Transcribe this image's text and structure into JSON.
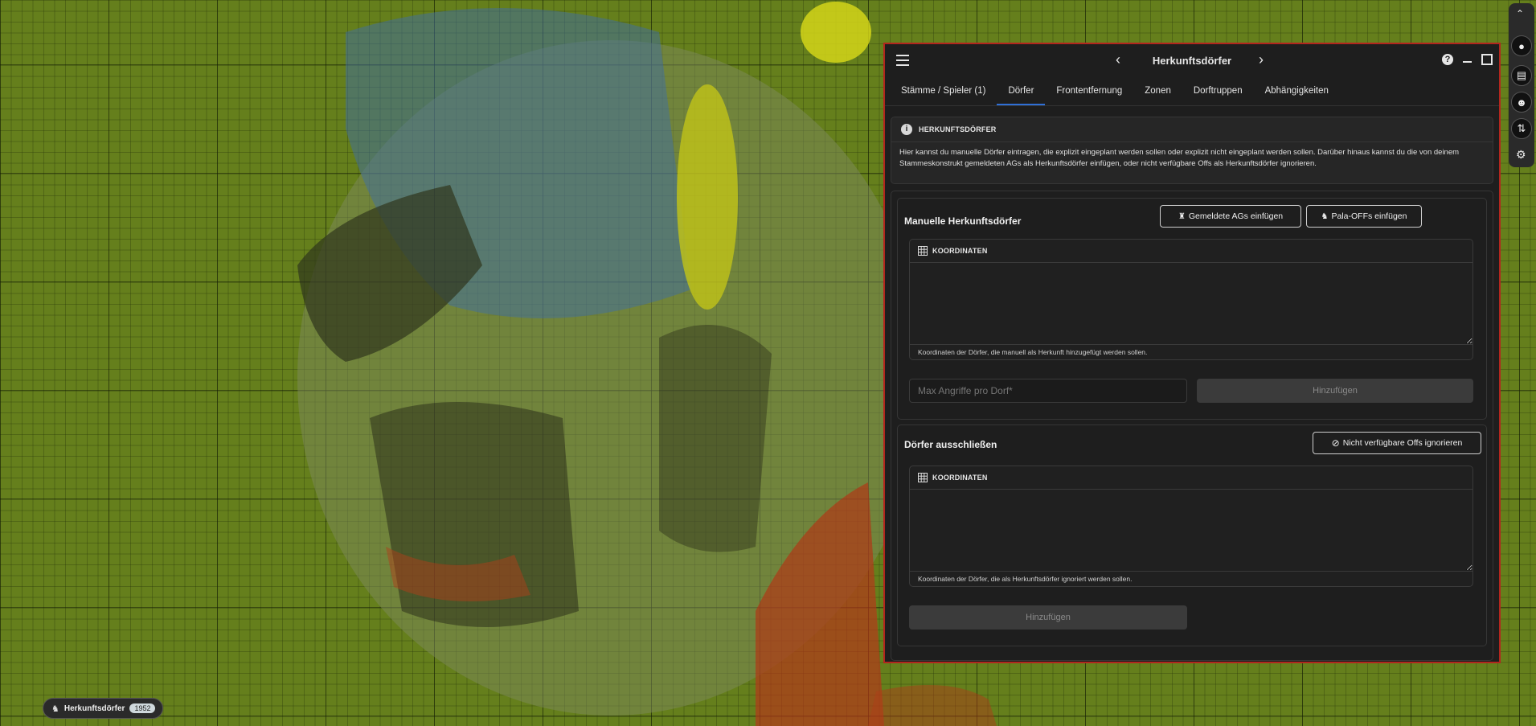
{
  "window": {
    "title": "Herkunftsdörfer",
    "help_icon": "help-icon",
    "minimize_icon": "minimize-icon",
    "maximize_icon": "maximize-icon"
  },
  "tabs": [
    {
      "label": "Stämme / Spieler (1)"
    },
    {
      "label": "Dörfer",
      "active": true
    },
    {
      "label": "Frontentfernung"
    },
    {
      "label": "Zonen"
    },
    {
      "label": "Dorftruppen"
    },
    {
      "label": "Abhängigkeiten"
    }
  ],
  "info": {
    "heading": "HERKUNFTSDÖRFER",
    "text": "Hier kannst du manuelle Dörfer eintragen, die explizit eingeplant werden sollen oder explizit nicht eingeplant werden sollen. Darüber hinaus kannst du die von deinem Stammeskonstrukt gemeldeten AGs als Herkunftsdörfer einfügen, oder nicht verfügbare Offs als Herkunftsdörfer ignorieren."
  },
  "manual": {
    "title": "Manuelle Herkunftsdörfer",
    "insert_ags_label": "Gemeldete AGs einfügen",
    "insert_pala_label": "Pala-OFFs einfügen",
    "coords_label": "KOORDINATEN",
    "coords_help": "Koordinaten der Dörfer, die manuell als Herkunft hinzugefügt werden sollen.",
    "max_attacks_placeholder": "Max Angriffe pro Dorf*",
    "add_label": "Hinzufügen"
  },
  "exclude": {
    "title": "Dörfer ausschließen",
    "ignore_offs_label": "Nicht verfügbare Offs ignorieren",
    "coords_label": "KOORDINATEN",
    "coords_help": "Koordinaten der Dörfer, die als Herkunftsdörfer ignoriert werden sollen.",
    "add_label": "Hinzufügen"
  },
  "status": {
    "label": "Herkunftsdörfer",
    "count": "1952"
  },
  "colors": {
    "map_green": "#657f1c",
    "panel_border": "#b3261e",
    "active_tab": "#2f6fd6"
  }
}
